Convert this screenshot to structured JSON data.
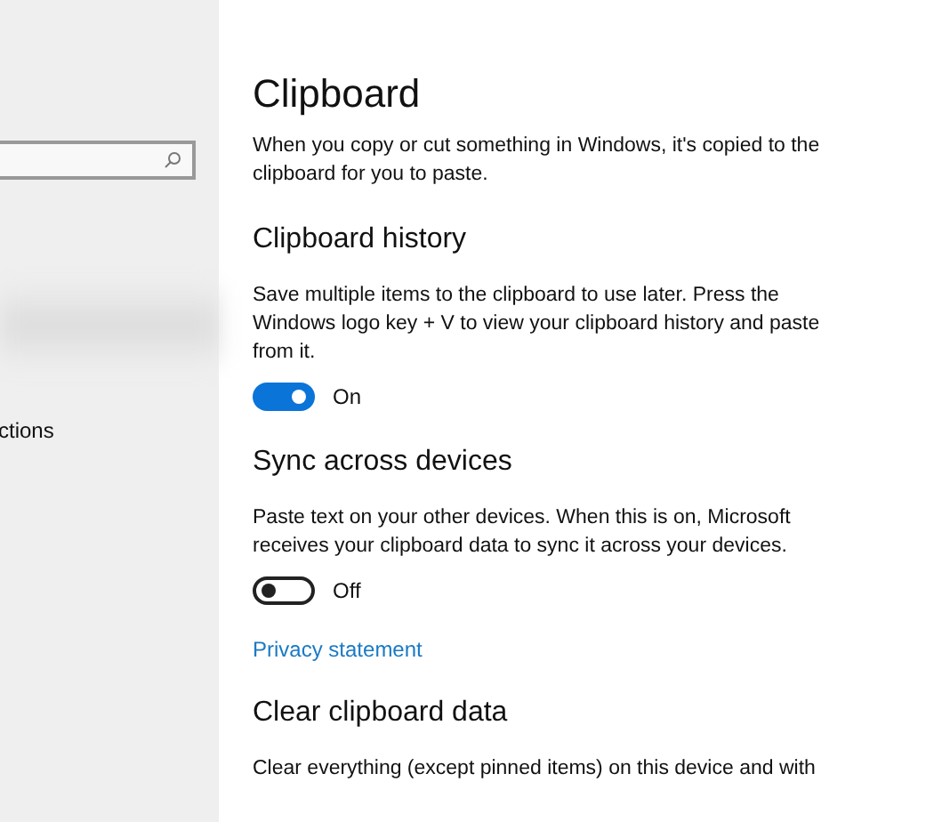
{
  "sidebar": {
    "items": [
      {
        "label": "ctions"
      }
    ]
  },
  "page": {
    "title": "Clipboard",
    "description": "When you copy or cut something in Windows, it's copied to the clipboard for you to paste."
  },
  "sections": [
    {
      "heading": "Clipboard history",
      "text": "Save multiple items to the clipboard to use later. Press the Windows logo key + V to view your clipboard history and paste from it.",
      "toggle": {
        "on": true,
        "label": "On"
      }
    },
    {
      "heading": "Sync across devices",
      "text": "Paste text on your other devices. When this is on, Microsoft receives your clipboard data to sync it across your devices.",
      "toggle": {
        "on": false,
        "label": "Off"
      },
      "link": "Privacy statement"
    },
    {
      "heading": "Clear clipboard data",
      "text": "Clear everything (except pinned items) on this device and with"
    }
  ]
}
